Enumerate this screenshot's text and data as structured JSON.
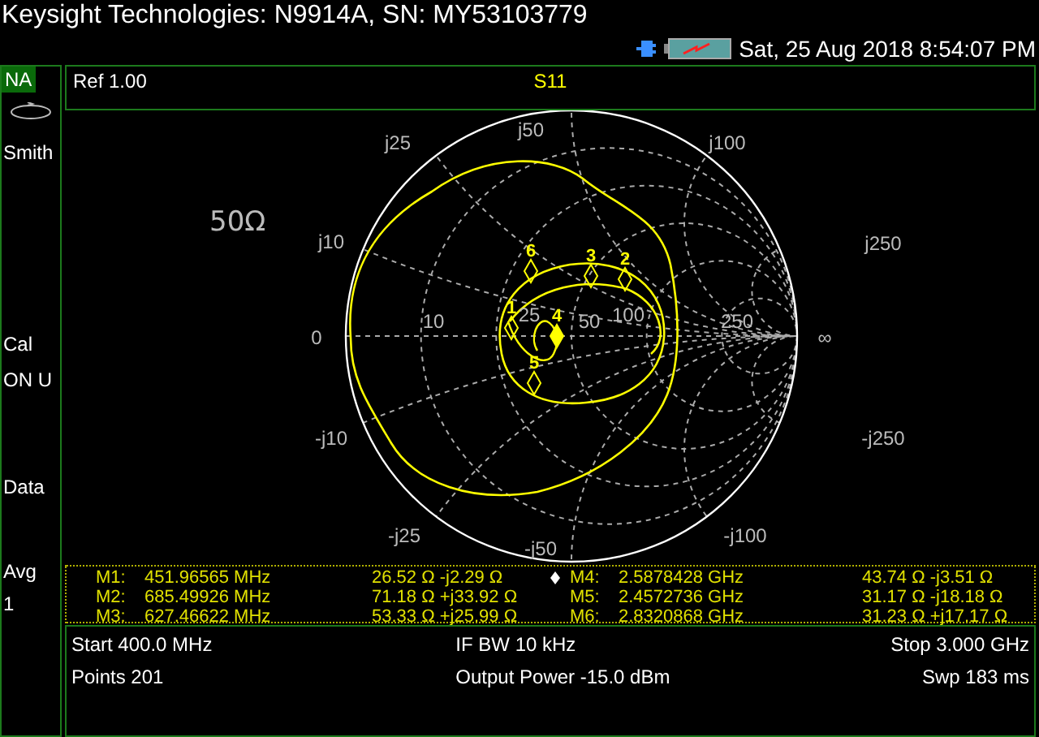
{
  "window": {
    "title": "Keysight Technologies: N9914A, SN: MY53103779"
  },
  "status_bar": {
    "datetime": "Sat, 25 Aug 2018 8:54:07 PM"
  },
  "sidebar": {
    "mode": "NA",
    "items": [
      {
        "kind": "icon"
      },
      {
        "kind": "text",
        "label": "Smith"
      },
      {
        "kind": "text",
        "label": "Cal"
      },
      {
        "kind": "text",
        "label": "ON U"
      },
      {
        "kind": "text",
        "label": "Data"
      },
      {
        "kind": "text",
        "label": "Avg"
      },
      {
        "kind": "text",
        "label": "1"
      }
    ]
  },
  "trace_header": {
    "reference": "Ref 1.00",
    "parameter": "S11"
  },
  "chart": {
    "impedance": "50Ω",
    "resistance_labels": [
      "0",
      "10",
      "25",
      "50",
      "100",
      "250",
      "∞"
    ],
    "reactance_labels": [
      "j10",
      "j25",
      "j50",
      "j100",
      "j250",
      "-j10",
      "-j25",
      "-j50",
      "-j100",
      "-j250"
    ],
    "markers": [
      {
        "label": "6",
        "active": false
      },
      {
        "label": "3",
        "active": false
      },
      {
        "label": "2",
        "active": false
      },
      {
        "label": "1",
        "active": false
      },
      {
        "label": "4",
        "active": true
      },
      {
        "label": "5",
        "active": false
      }
    ]
  },
  "marker_table": [
    {
      "name": "M1:",
      "frequency": "451.96565 MHz",
      "impedance": "26.52 Ω -j2.29 Ω",
      "active": false
    },
    {
      "name": "M2:",
      "frequency": "685.49926 MHz",
      "impedance": "71.18 Ω +j33.92 Ω",
      "active": false
    },
    {
      "name": "M3:",
      "frequency": "627.46622 MHz",
      "impedance": "53.33 Ω +j25.99 Ω",
      "active": false
    },
    {
      "name": "M4:",
      "frequency": "2.5878428 GHz",
      "impedance": "43.74 Ω -j3.51 Ω",
      "active": true
    },
    {
      "name": "M5:",
      "frequency": "2.4572736 GHz",
      "impedance": "31.17 Ω -j18.18 Ω",
      "active": false
    },
    {
      "name": "M6:",
      "frequency": "2.8320868 GHz",
      "impedance": "31.23 Ω +j17.17 Ω",
      "active": false
    }
  ],
  "settings": {
    "start": "Start 400.0 MHz",
    "points": "Points 201",
    "if_bw": "IF BW 10 kHz",
    "output_power": "Output Power -15.0 dBm",
    "stop": "Stop 3.000 GHz",
    "sweep_time": "Swp 183 ms"
  }
}
